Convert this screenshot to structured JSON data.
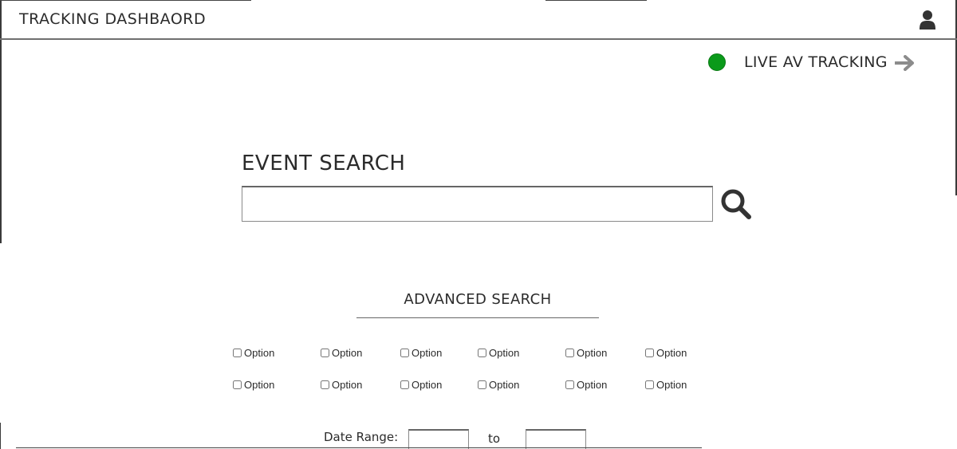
{
  "header": {
    "title": "TRACKING DASHBAORD",
    "user_icon": "user-icon"
  },
  "live_tracking": {
    "label": "LIVE AV TRACKING",
    "status_color": "#0a9a1a",
    "arrow_icon": "arrow-right-icon"
  },
  "event_search": {
    "title": "EVENT SEARCH",
    "input_value": "",
    "placeholder": "",
    "search_icon": "search-icon"
  },
  "advanced_search": {
    "title": "ADVANCED SEARCH",
    "options": [
      {
        "label": "Option",
        "checked": false
      },
      {
        "label": "Option",
        "checked": false
      },
      {
        "label": "Option",
        "checked": false
      },
      {
        "label": "Option",
        "checked": false
      },
      {
        "label": "Option",
        "checked": false
      },
      {
        "label": "Option",
        "checked": false
      },
      {
        "label": "Option",
        "checked": false
      },
      {
        "label": "Option",
        "checked": false
      },
      {
        "label": "Option",
        "checked": false
      },
      {
        "label": "Option",
        "checked": false
      },
      {
        "label": "Option",
        "checked": false
      },
      {
        "label": "Option",
        "checked": false
      }
    ]
  },
  "date_range": {
    "label": "Date Range:",
    "from_value": "",
    "separator": "to",
    "to_value": ""
  }
}
